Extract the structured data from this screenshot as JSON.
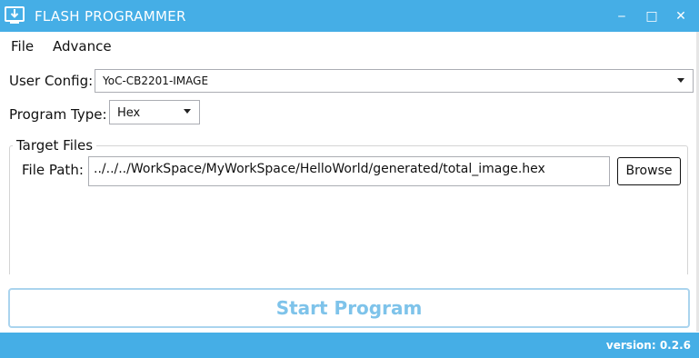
{
  "window": {
    "title": "FLASH PROGRAMMER",
    "icon": "download-icon",
    "controls": {
      "minimize": "‒",
      "maximize": "□",
      "close": "✕"
    }
  },
  "menu": {
    "items": [
      "File",
      "Advance"
    ]
  },
  "form": {
    "user_config_label": "User Config:",
    "user_config_value": "YoC-CB2201-IMAGE",
    "program_type_label": "Program Type:",
    "program_type_value": "Hex"
  },
  "target_files": {
    "legend": "Target Files",
    "file_path_label": "File Path:",
    "file_path_value": "../../../WorkSpace/MyWorkSpace/HelloWorld/generated/total_image.hex",
    "browse_label": "Browse"
  },
  "actions": {
    "start_label": "Start Program"
  },
  "status": {
    "version": "version: 0.2.6"
  },
  "colors": {
    "accent": "#45aee6",
    "start_text": "#7ec3ea"
  }
}
